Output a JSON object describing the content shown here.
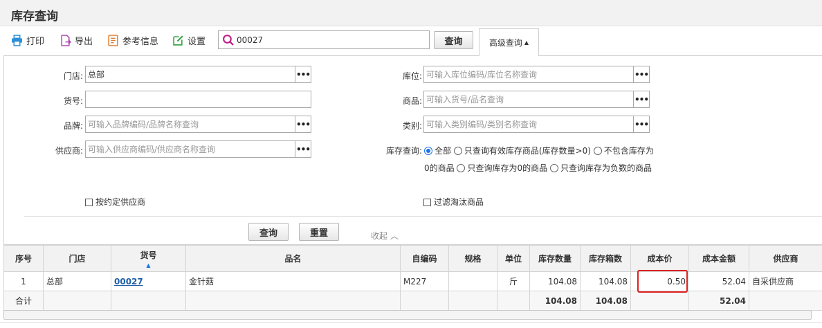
{
  "page": {
    "title": "库存查询"
  },
  "toolbar": {
    "print_label": "打印",
    "export_label": "导出",
    "reference_label": "参考信息",
    "settings_label": "设置",
    "search_value": "00027",
    "query_label": "查询",
    "advanced_label": "高级查询"
  },
  "filters": {
    "store_label": "门店:",
    "store_value": "总部",
    "item_no_label": "货号:",
    "item_no_value": "",
    "brand_label": "品牌:",
    "brand_placeholder": "可输入品牌编码/品牌名称查询",
    "supplier_label": "供应商:",
    "supplier_placeholder": "可输入供应商编码/供应商名称查询",
    "location_label": "库位:",
    "location_placeholder": "可输入库位编码/库位名称查询",
    "product_label": "商品:",
    "product_placeholder": "可输入货号/品名查询",
    "category_label": "类别:",
    "category_placeholder": "可输入类别编码/类别名称查询",
    "stock_query_label": "库存查询:",
    "stock_options": [
      "全部",
      "只查询有效库存商品(库存数量>0)",
      "不包含库存为0的商品",
      "只查询库存为0的商品",
      "只查询库存为负数的商品"
    ],
    "stock_selected_index": 0,
    "contract_supplier_label": "按约定供应商",
    "filter_discontinued_label": "过滤淘汰商品",
    "query_button": "查询",
    "reset_button": "重置",
    "collapse_label": "收起"
  },
  "table": {
    "columns": [
      "序号",
      "门店",
      "货号",
      "品名",
      "自编码",
      "规格",
      "单位",
      "库存数量",
      "库存箱数",
      "成本价",
      "成本金额",
      "供应商"
    ],
    "rows": [
      {
        "seq": "1",
        "store": "总部",
        "code": "00027",
        "name": "金针菇",
        "self_code": "M227",
        "spec": "",
        "unit": "斤",
        "qty": "104.08",
        "boxes": "104.08",
        "cost_price": "0.50",
        "cost_amount": "52.04",
        "supplier": "自采供应商"
      }
    ],
    "total": {
      "label": "合计",
      "qty": "104.08",
      "boxes": "104.08",
      "cost_amount": "52.04"
    }
  },
  "colors": {
    "accent_blue": "#1a73e8",
    "link_blue": "#1f5fa8",
    "highlight_red": "#e02020",
    "print_icon": "#2a8fd6",
    "export_icon": "#b040b0",
    "reference_icon": "#e07a2a",
    "settings_icon": "#3aa64a",
    "search_icon": "#c0208a"
  },
  "icons": {
    "print": "printer-icon",
    "export": "export-icon",
    "reference": "reference-list-icon",
    "settings": "settings-edit-icon",
    "search": "search-icon"
  }
}
